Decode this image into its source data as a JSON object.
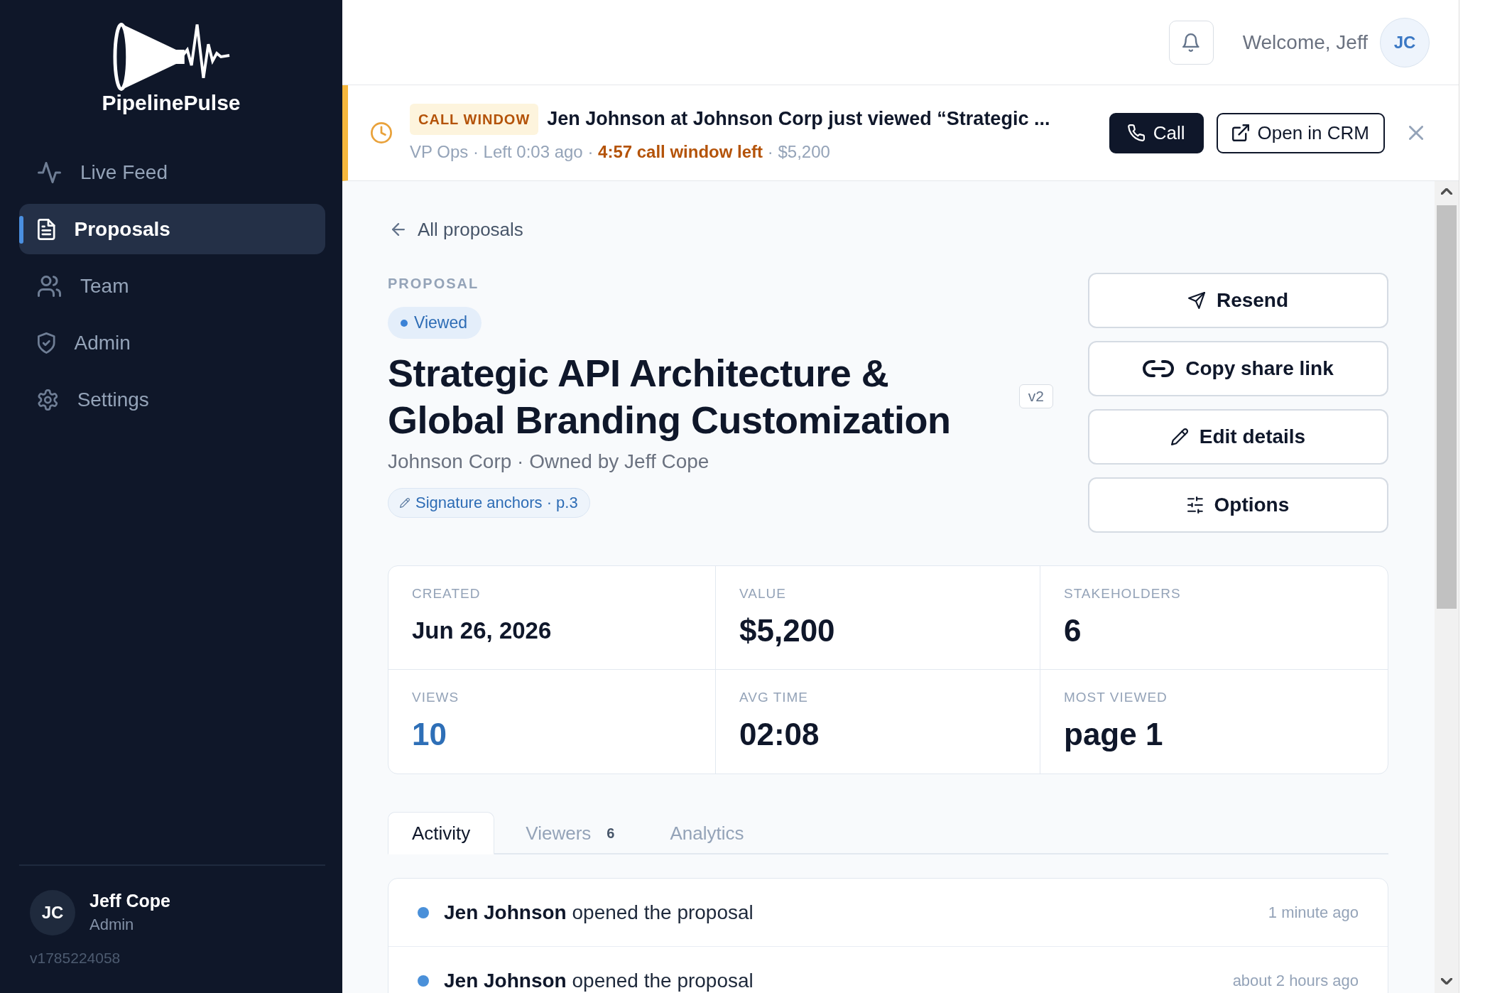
{
  "sidebar": {
    "logo_text": "PipelinePulse",
    "nav": [
      {
        "label": "Live Feed",
        "selected": false
      },
      {
        "label": "Proposals",
        "selected": true
      },
      {
        "label": "Team",
        "selected": false
      },
      {
        "label": "Admin",
        "selected": false
      },
      {
        "label": "Settings",
        "selected": false
      }
    ],
    "user": {
      "initials": "JC",
      "name": "Jeff Cope",
      "role": "Admin"
    },
    "version": "v1785224058"
  },
  "header": {
    "welcome": "Welcome, Jeff",
    "avatar_initials": "JC"
  },
  "alert": {
    "badge": "CALL WINDOW",
    "headline": "Jen Johnson at Johnson Corp just viewed “Strategic ...",
    "meta": "VP Ops · Left 0:03 ago · **4:57 call window left** · $5,200",
    "buttons": [
      {
        "label": "Call",
        "kind": "primary"
      },
      {
        "label": "Open in CRM",
        "kind": "outline"
      }
    ]
  },
  "proposal": {
    "back_link": "All proposals",
    "eyebrow": "PROPOSAL",
    "status": "Viewed",
    "title": "Strategic API Architecture & Global Branding Customization",
    "version": "v2",
    "subtitle": "Johnson Corp · Owned by Jeff Cope",
    "signature_tag": "Signature anchors · p.3",
    "actions": [
      {
        "label": "Resend"
      },
      {
        "label": "Copy share link"
      },
      {
        "label": "Edit details"
      },
      {
        "label": "Options"
      }
    ]
  },
  "stats": [
    {
      "label": "CREATED",
      "value": "Jun 26, 2026",
      "kind": "date"
    },
    {
      "label": "VALUE",
      "value": "$5,200",
      "kind": "plain"
    },
    {
      "label": "STAKEHOLDERS",
      "value": "6",
      "kind": "plain"
    },
    {
      "label": "VIEWS",
      "value": "10",
      "kind": "accent"
    },
    {
      "label": "AVG TIME",
      "value": "02:08",
      "kind": "plain"
    },
    {
      "label": "MOST VIEWED",
      "value": "page 1",
      "kind": "plain"
    }
  ],
  "tabs": [
    {
      "label": "Activity",
      "selected": true
    },
    {
      "label": "Viewers",
      "count": "6",
      "selected": false
    },
    {
      "label": "Analytics",
      "selected": false
    }
  ],
  "activity": [
    {
      "text": "**Jen Johnson** opened the proposal",
      "time": "1 minute ago"
    },
    {
      "text": "**Jen Johnson** opened the proposal",
      "time": "about 2 hours ago"
    }
  ]
}
